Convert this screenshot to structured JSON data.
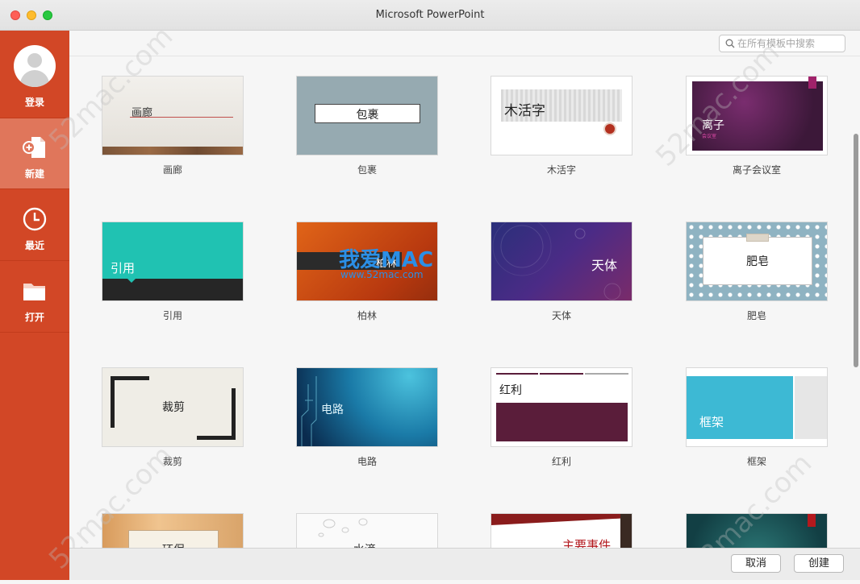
{
  "window": {
    "title": "Microsoft PowerPoint"
  },
  "sidebar": {
    "login_label": "登录",
    "items": [
      {
        "label": "新建",
        "icon": "new-document-icon",
        "active": true
      },
      {
        "label": "最近",
        "icon": "clock-icon",
        "active": false
      },
      {
        "label": "打开",
        "icon": "folder-icon",
        "active": false
      }
    ]
  },
  "search": {
    "placeholder": "在所有模板中搜索"
  },
  "templates": [
    {
      "label": "画廊",
      "thumb_text": "画廊"
    },
    {
      "label": "包裹",
      "thumb_text": "包裹"
    },
    {
      "label": "木活字",
      "thumb_text": "木活字"
    },
    {
      "label": "离子会议室",
      "thumb_text": "离子",
      "thumb_sub": "会议室"
    },
    {
      "label": "引用",
      "thumb_text": "引用"
    },
    {
      "label": "柏林",
      "thumb_text": "柏林"
    },
    {
      "label": "天体",
      "thumb_text": "天体"
    },
    {
      "label": "肥皂",
      "thumb_text": "肥皂"
    },
    {
      "label": "裁剪",
      "thumb_text": "裁剪"
    },
    {
      "label": "电路",
      "thumb_text": "电路"
    },
    {
      "label": "红利",
      "thumb_text": "红利"
    },
    {
      "label": "框架",
      "thumb_text": "框架"
    },
    {
      "label": "",
      "thumb_text": "环保"
    },
    {
      "label": "",
      "thumb_text": "水滴"
    },
    {
      "label": "",
      "thumb_text": "主要事件"
    },
    {
      "label": "",
      "thumb_text": ""
    }
  ],
  "footer": {
    "cancel_label": "取消",
    "create_label": "创建"
  },
  "watermark": {
    "site": "52mac.com",
    "promo_title": "我爱MAC",
    "promo_url": "www.52mac.com"
  },
  "colors": {
    "accent": "#d24726",
    "sidebar_active": "#e0765b"
  }
}
